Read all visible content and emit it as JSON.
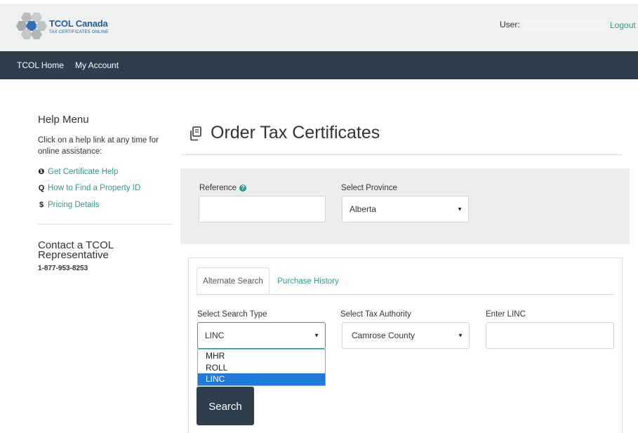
{
  "header": {
    "logo_name": "TCOL Canada",
    "logo_subtitle": "TAX CERTIFICATES ONLINE",
    "user_label": "User:",
    "user_value": "",
    "logout_label": "Logout"
  },
  "nav": {
    "items": [
      {
        "label": "TCOL Home"
      },
      {
        "label": "My Account"
      }
    ]
  },
  "help": {
    "title": "Help Menu",
    "description": "Click on a help link at any time for online assistance:",
    "links": [
      {
        "icon": "info-circle-icon",
        "glyph": "❶",
        "label": "Get Certificate Help"
      },
      {
        "icon": "search-icon",
        "glyph": "Q",
        "label": "How to Find a Property ID"
      },
      {
        "icon": "dollar-icon",
        "glyph": "$",
        "label": "Pricing Details"
      }
    ],
    "contact_title": "Contact a TCOL Representative",
    "contact_phone": "1-877-953-8253"
  },
  "main": {
    "title": "Order Tax Certificates",
    "title_icon": "copy-icon",
    "reference_label": "Reference",
    "reference_value": "",
    "province_label": "Select Province",
    "province_value": "Alberta",
    "tabs": [
      {
        "label": "Alternate Search",
        "active": true
      },
      {
        "label": "Purchase History",
        "active": false
      }
    ],
    "search_type_label": "Select Search Type",
    "search_type_value": "LINC",
    "search_type_options": [
      "MHR",
      "ROLL",
      "LINC"
    ],
    "search_type_selected": "LINC",
    "tax_authority_label": "Select Tax Authority",
    "tax_authority_value": "Camrose County",
    "linc_label": "Enter LINC",
    "linc_value": "",
    "search_button": "Search"
  },
  "colors": {
    "accent": "#2a9d8f",
    "navbar": "#2e3e4d",
    "selection": "#1e7bd8"
  }
}
